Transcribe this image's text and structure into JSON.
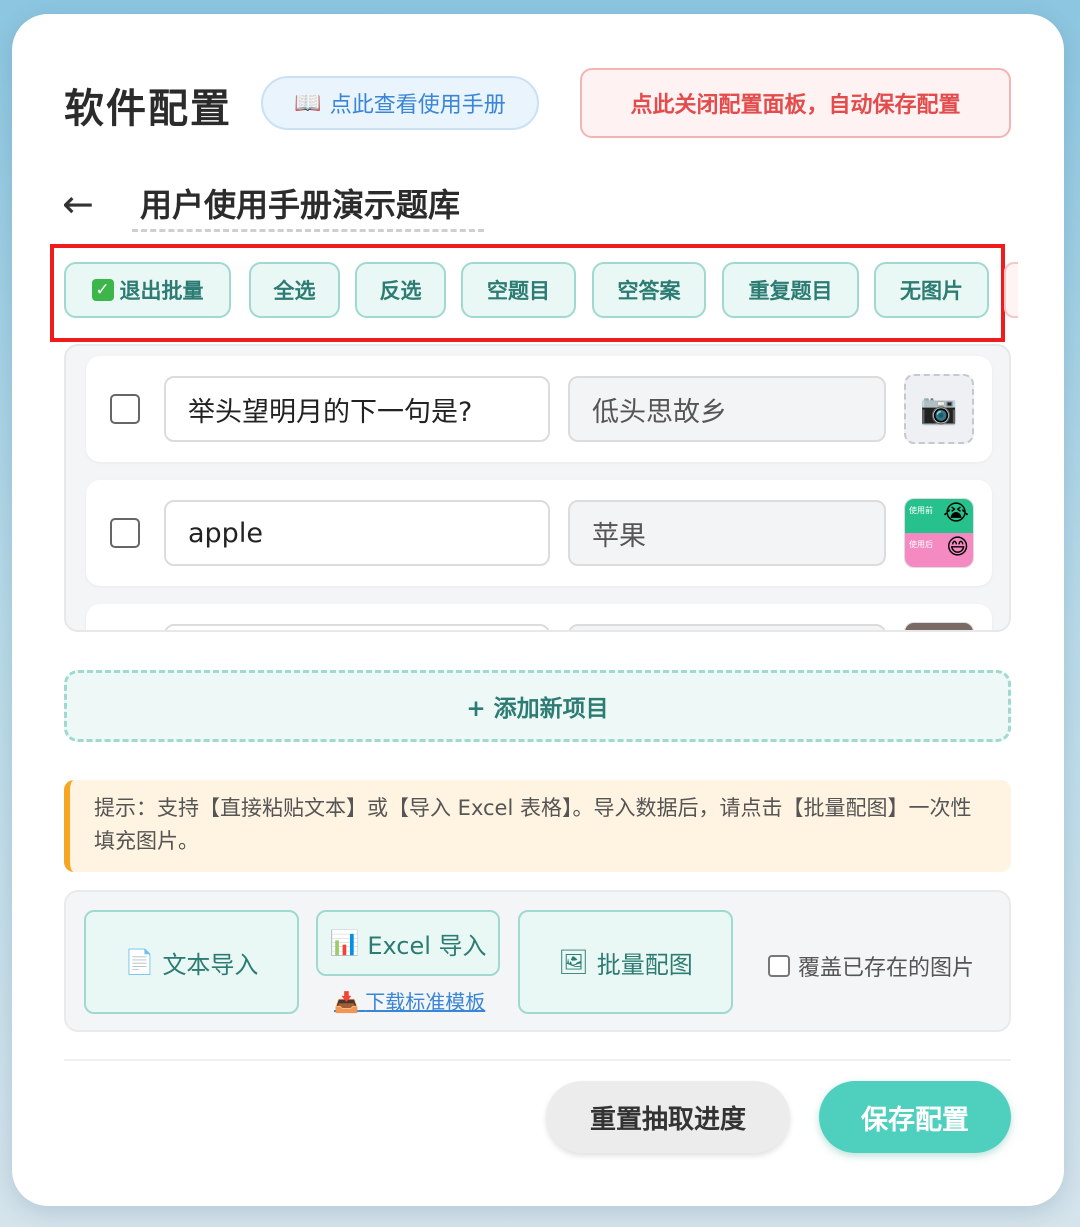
{
  "header": {
    "title": "软件配置",
    "manual_icon": "📖",
    "manual_label": "点此查看使用手册",
    "close_label": "点此关闭配置面板，自动保存配置"
  },
  "set": {
    "back_icon": "←",
    "name": "用户使用手册演示题库"
  },
  "batch_chips": [
    {
      "label": "退出批量",
      "icon": "✓"
    },
    {
      "label": "全选"
    },
    {
      "label": "反选"
    },
    {
      "label": "空题目"
    },
    {
      "label": "空答案"
    },
    {
      "label": "重复题目"
    },
    {
      "label": "无图片"
    }
  ],
  "items": [
    {
      "question": "举头望明月的下一句是?",
      "answer": "低头思故乡",
      "image": "camera-icon",
      "image_glyph": "📷"
    },
    {
      "question": "apple",
      "answer": "苹果",
      "image": "thumbnail",
      "thumb_top_label": "使用前",
      "thumb_top_emoji": "😭",
      "thumb_bottom_label": "使用后",
      "thumb_bottom_emoji": "😄"
    },
    {
      "question": "",
      "answer": "",
      "image": "thumbnail"
    }
  ],
  "add_item_label": "+ 添加新项目",
  "tip": "提示：支持【直接粘贴文本】或【导入 Excel 表格】。导入数据后，请点击【批量配图】一次性填充图片。",
  "tools": {
    "text_import_icon": "📄",
    "text_import_label": "文本导入",
    "excel_import_icon": "📊",
    "excel_import_label": "Excel 导入",
    "download_icon": "📥",
    "download_label": "下载标准模板",
    "batch_image_icon": "🖼",
    "batch_image_label": "批量配图",
    "overwrite_label": "覆盖已存在的图片",
    "overwrite_checked": false
  },
  "footer": {
    "reset_label": "重置抽取进度",
    "save_label": "保存配置"
  },
  "colors": {
    "accent": "#4fcfbe",
    "chip_bg": "#e9f7f5",
    "danger": "#e34c4c",
    "link": "#3a86d6",
    "highlight_box": "#f01c1c"
  }
}
